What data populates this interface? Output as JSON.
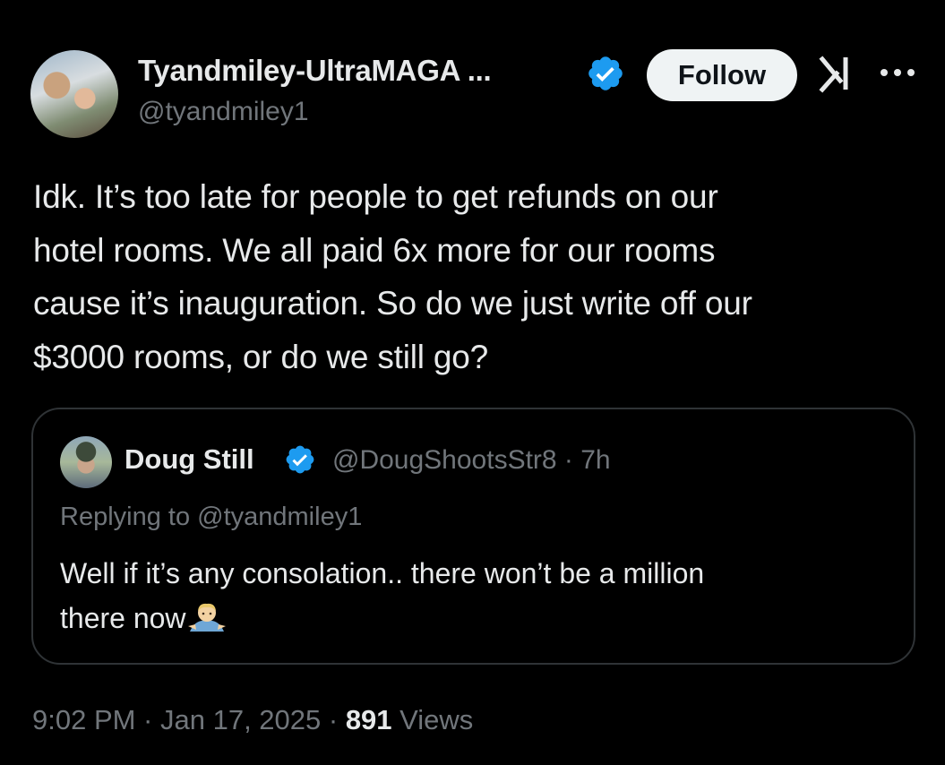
{
  "tweet": {
    "display_name": "Tyandmiley-UltraMAGA ...",
    "handle": "@tyandmiley1",
    "follow_label": "Follow",
    "body": "Idk. It’s too late for people to get refunds on our\nhotel rooms. We all paid 6x more for our rooms\ncause it’s inauguration. So do we just write off our\n$3000 rooms, or do we still go?"
  },
  "quote": {
    "display_name": "Doug Still",
    "handle_time": "@DougShootsStr8 · 7h",
    "replying_to": "Replying to @tyandmiley1",
    "body_line1": "Well if it’s any consolation.. there won’t be a million",
    "body_line2": "there now"
  },
  "footer": {
    "timestamp": "9:02 PM · Jan 17, 2025 · ",
    "views_count": "891",
    "views_label": " Views"
  },
  "colors": {
    "background": "#000000",
    "text_primary": "#e7e9ea",
    "text_secondary": "#71767b",
    "verified_blue": "#1d9bf0",
    "border": "#2f3336"
  },
  "icons": {
    "verified": "verified-badge-icon",
    "grok": "grok-icon",
    "more": "more-options-icon",
    "emoji": "man-shrugging-emoji"
  }
}
